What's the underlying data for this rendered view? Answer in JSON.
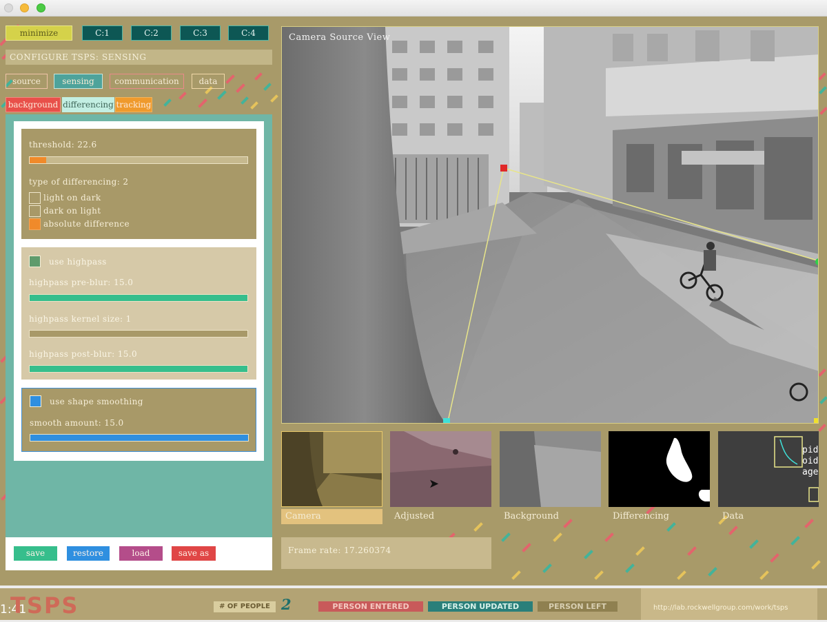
{
  "toolbar": {
    "minimize_label": "minimize",
    "camera_buttons": [
      "C:1",
      "C:2",
      "C:3",
      "C:4"
    ]
  },
  "header": {
    "configure_label": "CONFIGURE TSPS: SENSING"
  },
  "tabs": [
    "source",
    "sensing",
    "communication",
    "data"
  ],
  "subtabs": [
    "background",
    "differencing",
    "tracking"
  ],
  "differencing": {
    "threshold_label": "threshold: 22.6",
    "threshold_value": 22.6,
    "threshold_max": 255,
    "type_label": "type of differencing: 2",
    "options": [
      "light on dark",
      "dark on light",
      "absolute difference"
    ],
    "selected_option_index": 2
  },
  "highpass": {
    "use_label": "use highpass",
    "preblur_label": "highpass pre-blur: 15.0",
    "preblur_value": 15.0,
    "kernel_label": "highpass kernel size: 1",
    "kernel_value": 1,
    "postblur_label": "highpass post-blur: 15.0",
    "postblur_value": 15.0,
    "fill_color": "#36be8c"
  },
  "smoothing": {
    "use_label": "use shape smoothing",
    "amount_label": "smooth amount: 15.0",
    "amount_value": 15.0,
    "fill_color": "#2f8fe0"
  },
  "actions": {
    "save": "save",
    "restore": "restore",
    "load": "load",
    "save_as": "save as"
  },
  "camera_view": {
    "title": "Camera Source View"
  },
  "thumbnails": [
    "Camera",
    "Adjusted",
    "Background",
    "Differencing",
    "Data"
  ],
  "data_thumb": {
    "lines": [
      "pid: ",
      "oid: ",
      "age: "
    ]
  },
  "status": {
    "frame_rate_label": "Frame rate: 17.260374"
  },
  "footer": {
    "time": "1:41",
    "logo": "TSPS",
    "people_label": "# OF PEOPLE",
    "people_count": "2",
    "events": [
      "PERSON ENTERED",
      "PERSON UPDATED",
      "PERSON LEFT"
    ],
    "website": "http://lab.rockwellgroup.com/work/tsps"
  },
  "colors": {
    "accent_orange": "#f08a2a",
    "accent_teal": "#6fb6a6",
    "panel_tan": "#a89968"
  }
}
